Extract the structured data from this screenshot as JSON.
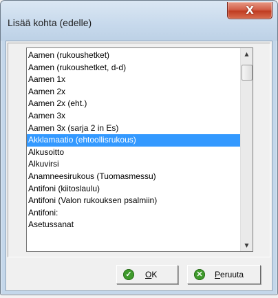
{
  "window": {
    "title": "Lisää kohta (edelle)",
    "close_symbol": "X"
  },
  "list": {
    "items": [
      "Aamen (rukoushetket)",
      "Aamen (rukoushetket, d-d)",
      "Aamen 1x",
      "Aamen 2x",
      "Aamen 2x (eht.)",
      "Aamen 3x",
      "Aamen 3x (sarja 2 in Es)",
      "Akklamaatio (ehtoollisrukous)",
      "Alkusoitto",
      "Alkuvirsi",
      "Anamneesirukous (Tuomasmessu)",
      "Antifoni (kiitoslaulu)",
      "Antifoni (Valon rukouksen psalmiin)",
      "Antifoni:",
      "Asetussanat"
    ],
    "selected_index": 7
  },
  "buttons": {
    "ok": {
      "mnemonic": "O",
      "rest": "K",
      "icon": "check-icon"
    },
    "cancel": {
      "mnemonic": "P",
      "rest": "eruuta",
      "icon": "cancel-icon"
    }
  },
  "colors": {
    "selection": "#3399ff",
    "close_button": "#c8452b",
    "icon_green": "#3f9a2c"
  }
}
